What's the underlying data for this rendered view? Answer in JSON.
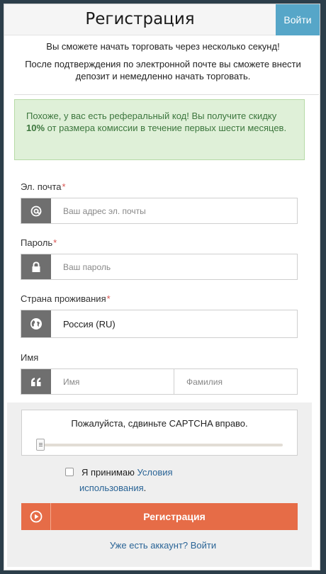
{
  "header": {
    "title": "Регистрация",
    "login_button": "Войти"
  },
  "intro": {
    "line1": "Вы сможете начать торговать через несколько секунд!",
    "line2": "После подтверждения по электронной почте вы сможете внести депозит и немедленно начать торговать."
  },
  "referral_alert": {
    "prefix": "Похоже, у вас есть реферальный код! Вы получите скидку ",
    "discount": "10%",
    "suffix": " от размера комиссии в течение первых шести месяцев."
  },
  "fields": {
    "email": {
      "label": "Эл. почта",
      "required_mark": "*",
      "placeholder": "Ваш адрес эл. почты",
      "icon": "at-icon"
    },
    "password": {
      "label": "Пароль",
      "required_mark": "*",
      "placeholder": "Ваш пароль",
      "icon": "lock-icon"
    },
    "country": {
      "label": "Страна проживания",
      "required_mark": "*",
      "value": "Россия (RU)",
      "icon": "globe-icon"
    },
    "name": {
      "label": "Имя",
      "first_placeholder": "Имя",
      "last_placeholder": "Фамилия",
      "icon": "quote-icon"
    }
  },
  "captcha": {
    "text": "Пожалуйста, сдвиньте CAPTCHA вправо.",
    "slider_position": 0
  },
  "terms": {
    "prefix": "Я принимаю ",
    "link_part1": "Условия",
    "link_part2": "использования",
    "suffix": ".",
    "checked": false
  },
  "submit": {
    "label": "Регистрация",
    "icon": "play-circle-icon",
    "color": "#e66c47"
  },
  "footer": {
    "already_account": "Уже есть аккаунт? Войти"
  },
  "colors": {
    "accent_blue": "#56a6c8",
    "alert_bg": "#dff0d8",
    "alert_text": "#3c763d",
    "icon_bg": "#6f6f6f",
    "link": "#2a6496"
  }
}
